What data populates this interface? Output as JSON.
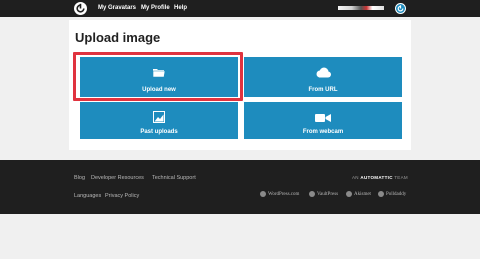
{
  "topbar": {
    "logo_icon": "gravatar-logo-icon",
    "nav": [
      "My Gravatars",
      "My Profile",
      "Help"
    ],
    "account_icon": "gravatar-account-icon"
  },
  "main": {
    "title": "Upload image",
    "tiles": [
      {
        "label": "Upload new",
        "icon": "folder-icon",
        "highlighted": true
      },
      {
        "label": "From URL",
        "icon": "cloud-icon"
      },
      {
        "label": "Past uploads",
        "icon": "image-icon"
      },
      {
        "label": "From webcam",
        "icon": "video-camera-icon"
      }
    ]
  },
  "footer": {
    "row1": [
      "Blog",
      "Developer Resources",
      "Technical Support"
    ],
    "row2": [
      "Languages",
      "Privacy Policy"
    ],
    "team": {
      "prefix": "AN",
      "brand": "AUTOMATTIC",
      "suffix": "TEAM"
    },
    "brands": [
      "WordPress.com",
      "VaultPress",
      "Akismet",
      "Polldaddy"
    ]
  },
  "colors": {
    "accent": "#1e8cbe",
    "highlight": "#e0333f",
    "bar": "#1f1f1f"
  }
}
